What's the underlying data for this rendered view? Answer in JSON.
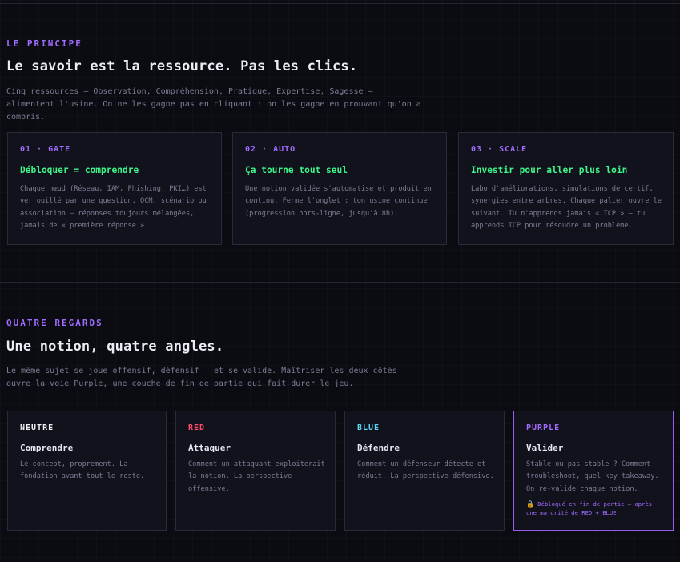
{
  "principle": {
    "eyebrow": "LE PRINCIPE",
    "title": "Le savoir est la ressource. Pas les clics.",
    "lead": "Cinq ressources — Observation, Compréhension, Pratique, Expertise, Sagesse — alimentent l'usine. On ne les gagne pas en cliquant : on les gagne en prouvant qu'on a compris.",
    "cards": [
      {
        "tag": "01 · GATE",
        "title": "Débloquer = comprendre",
        "body": "Chaque nœud (Réseau, IAM, Phishing, PKI…) est verrouillé par une question. QCM, scénario ou association — réponses toujours mélangées, jamais de « première réponse »."
      },
      {
        "tag": "02 · AUTO",
        "title": "Ça tourne tout seul",
        "body": "Une notion validée s'automatise et produit en continu. Ferme l'onglet : ton usine continue (progression hors-ligne, jusqu'à 8h)."
      },
      {
        "tag": "03 · SCALE",
        "title": "Investir pour aller plus loin",
        "body": "Labo d'améliorations, simulations de certif, synergies entre arbres. Chaque palier ouvre le suivant. Tu n'apprends jamais « TCP » — tu apprends TCP pour résoudre un problème."
      }
    ]
  },
  "angles": {
    "eyebrow": "QUATRE REGARDS",
    "title": "Une notion, quatre angles.",
    "lead": "Le même sujet se joue offensif, défensif — et se valide. Maîtriser les deux côtés ouvre la voie Purple, une couche de fin de partie qui fait durer le jeu.",
    "cards": [
      {
        "tag": "NEUTRE",
        "title": "Comprendre",
        "body": "Le concept, proprement. La fondation avant tout le reste."
      },
      {
        "tag": "RED",
        "title": "Attaquer",
        "body": "Comment un attaquant exploiterait la notion. La perspective offensive."
      },
      {
        "tag": "BLUE",
        "title": "Défendre",
        "body": "Comment un défenseur détecte et réduit. La perspective défensive."
      },
      {
        "tag": "PURPLE",
        "title": "Valider",
        "body": "Stable ou pas stable ? Comment troubleshoot, quel key takeaway. On re-valide chaque notion.",
        "unlock_icon": "🔒",
        "unlock": "Débloqué en fin de partie — après une majorité de RED + BLUE."
      }
    ]
  },
  "colors": {
    "accent_purple": "#a06bff",
    "accent_green": "#3ef58a",
    "red": "#ff4d6d",
    "blue": "#5ed3f7"
  }
}
